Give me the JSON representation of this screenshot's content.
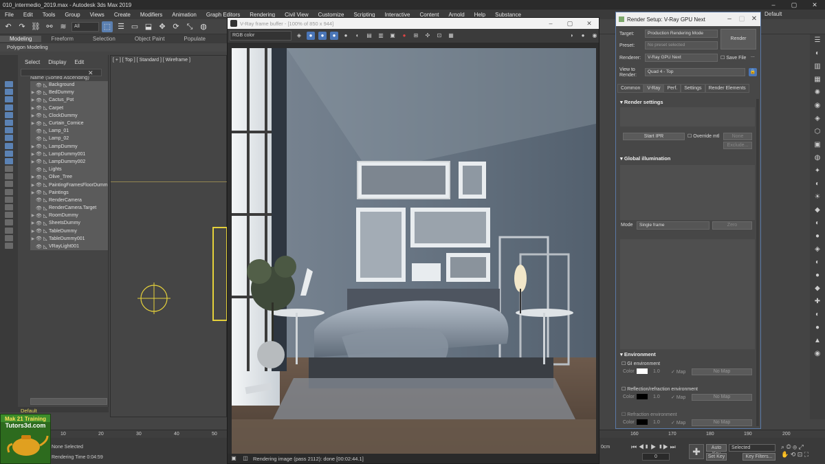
{
  "app": {
    "title": "010_intermedio_2019.max - Autodesk 3ds Max 2019",
    "workspace": "Default"
  },
  "menu": [
    "File",
    "Edit",
    "Tools",
    "Group",
    "Views",
    "Create",
    "Modifiers",
    "Animation",
    "Graph Editors",
    "Rendering",
    "Civil View",
    "Customize",
    "Scripting",
    "Interactive",
    "Content",
    "Arnold",
    "Help",
    "Substance"
  ],
  "toolbar": {
    "selection_filter": "All"
  },
  "ribbon": {
    "tabs": [
      "Modeling",
      "Freeform",
      "Selection",
      "Object Paint",
      "Populate"
    ],
    "active": "Modeling",
    "panel": "Polygon Modeling"
  },
  "explorer": {
    "menu": [
      "Select",
      "Display",
      "Edit"
    ],
    "column_header": "Name (Sorted Ascending)",
    "items": [
      {
        "name": "Background",
        "exp": false
      },
      {
        "name": "BedDummy",
        "exp": true
      },
      {
        "name": "Cactus_Pot",
        "exp": true
      },
      {
        "name": "Carpet",
        "exp": true
      },
      {
        "name": "ClockDummy",
        "exp": true
      },
      {
        "name": "Curtain_Cornice",
        "exp": true
      },
      {
        "name": "Lamp_01",
        "exp": false
      },
      {
        "name": "Lamp_02",
        "exp": false
      },
      {
        "name": "LampDummy",
        "exp": true
      },
      {
        "name": "LampDummy001",
        "exp": true
      },
      {
        "name": "LampDummy002",
        "exp": true
      },
      {
        "name": "Lights",
        "exp": false
      },
      {
        "name": "Olive_Tree",
        "exp": true
      },
      {
        "name": "PaintingFramesFloorDumm",
        "exp": true
      },
      {
        "name": "Paintings",
        "exp": true
      },
      {
        "name": "RenderCamera",
        "exp": false
      },
      {
        "name": "RenderCamera.Target",
        "exp": false
      },
      {
        "name": "RoomDummy",
        "exp": true
      },
      {
        "name": "SheetsDummy",
        "exp": true
      },
      {
        "name": "TableDummy",
        "exp": true
      },
      {
        "name": "TableDummy001",
        "exp": true
      },
      {
        "name": "VRayLight001",
        "exp": false
      }
    ],
    "layer": "Default"
  },
  "viewport": {
    "label": "[ + ] [ Top ] [ Standard ] [ Wireframe ]"
  },
  "vfb": {
    "title": "V-Ray frame buffer - [100% of 850 x 944]",
    "channel": "RGB color",
    "status": "Rendering image (pass 2112): done [00:02:44.1]"
  },
  "render_setup": {
    "title": "Render Setup: V-Ray GPU Next",
    "target_label": "Target:",
    "target": "Production Rendering Mode",
    "preset_label": "Preset:",
    "preset": "No preset selected",
    "renderer_label": "Renderer:",
    "renderer": "V-Ray GPU Next",
    "save_file": "Save File",
    "view_label": "View to\nRender:",
    "view": "Quad 4 - Top",
    "render_button": "Render",
    "tabs": [
      "Common",
      "V-Ray",
      "Perf.",
      "Settings",
      "Render Elements"
    ],
    "active_tab": "V-Ray",
    "sections": {
      "render_settings": "Render settings",
      "start_ipr": "Start IPR",
      "override_mtl": "Override mtl",
      "none": "None",
      "exclude": "Exclude...",
      "global_illumination": "Global illumination",
      "mode_label": "Mode",
      "mode": "Single frame",
      "zero": "Zero",
      "environment": "Environment",
      "gi_env": "GI environment",
      "refl_env": "Reflection/refraction environment",
      "refr_env": "Refraction environment",
      "color_label": "Color",
      "mult": "1.0",
      "map_label": "Map",
      "no_map": "No Map"
    }
  },
  "timeline": {
    "ticks": [
      "10",
      "20",
      "30",
      "40",
      "50",
      "160",
      "170",
      "180",
      "190",
      "200"
    ]
  },
  "status": {
    "selection": "None Selected",
    "render_time": "Rendering Time 0:04:59",
    "auto_key": "Auto Key",
    "set_key": "Set Key",
    "selected": "Selected",
    "key_filters": "Key Filters...",
    "frame": "0"
  },
  "watermark": {
    "line1": "Mak 21 Training",
    "line2": "Tutors3d.com"
  },
  "colors": {
    "accent": "#5b82b4",
    "bg": "#444444"
  }
}
